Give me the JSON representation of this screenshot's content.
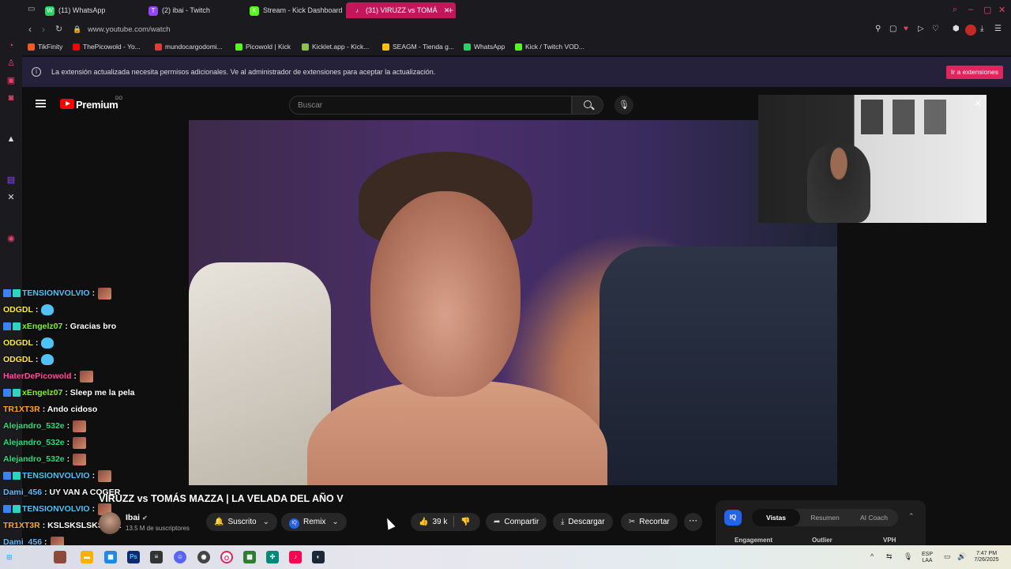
{
  "browser": {
    "tabs": [
      {
        "label": "(11) WhatsApp",
        "icon": "whatsapp-icon",
        "color": "#25d366",
        "glyph": "W"
      },
      {
        "label": "(2) ibai - Twitch",
        "icon": "twitch-icon",
        "color": "#9146ff",
        "glyph": "T"
      },
      {
        "label": "Stream - Kick Dashboard",
        "icon": "kick-icon",
        "color": "#53fc18",
        "glyph": "K"
      },
      {
        "label": "(31) VIRUZZ vs TOMÁ",
        "icon": "audio-icon",
        "color": "#c2185b",
        "glyph": "♪"
      }
    ],
    "new_tab": "+",
    "url": "www.youtube.com/watch",
    "bookmarks": [
      {
        "label": "TikFinity",
        "color": "#ff5722"
      },
      {
        "label": "ThePicowold - Yo...",
        "color": "#ff0000"
      },
      {
        "label": "mundocargodomi...",
        "color": "#e53935"
      },
      {
        "label": "Picowold | Kick",
        "color": "#53fc18"
      },
      {
        "label": "Kicklet.app - Kick...",
        "color": "#8bc34a"
      },
      {
        "label": "SEAGM - Tienda g...",
        "color": "#ffc107"
      },
      {
        "label": "WhatsApp",
        "color": "#25d366"
      },
      {
        "label": "Kick / Twitch VOD...",
        "color": "#53fc18"
      }
    ]
  },
  "notice": {
    "message": "La extensión actualizada necesita permisos adicionales. Ve al administrador de extensiones para aceptar la actualización.",
    "button": "Ir a extensiones"
  },
  "youtube": {
    "brand": "Premium",
    "brand_sup": "DO",
    "search_placeholder": "Buscar",
    "video_title": "VIRUZZ vs TOMÁS MAZZA | LA VELADA DEL AÑO V",
    "channel": {
      "name": "Ibai",
      "verified": "✔",
      "subscribers": "13.5 M de suscriptores"
    },
    "actions": {
      "subscribe": "Suscrito",
      "remix": "Remix",
      "likes": "39 k",
      "share": "Compartir",
      "download": "Descargar",
      "clip": "Recortar",
      "more": "⋯"
    }
  },
  "chat": [
    {
      "user": "TENSIONVOLVIO",
      "color": "#4fc3f7",
      "badges": true,
      "text": ":",
      "emote": "face"
    },
    {
      "user": "ODGDL",
      "color": "#ffeb3b",
      "badges": false,
      "text": ":",
      "emote": "cat"
    },
    {
      "user": "xEngelz07",
      "color": "#7cfc00",
      "badges": true,
      "text": ": Gracias bro",
      "emote": ""
    },
    {
      "user": "ODGDL",
      "color": "#ffeb3b",
      "badges": false,
      "text": ":",
      "emote": "cat"
    },
    {
      "user": "ODGDL",
      "color": "#ffeb3b",
      "badges": false,
      "text": ":",
      "emote": "cat"
    },
    {
      "user": "HaterDePicowold",
      "color": "#ff4fa3",
      "badges": false,
      "text": ":",
      "emote": "face"
    },
    {
      "user": "xEngelz07",
      "color": "#7cfc00",
      "badges": true,
      "text": ": Sleep me la pela",
      "emote": ""
    },
    {
      "user": "TR1XT3R",
      "color": "#ffa726",
      "badges": false,
      "text": ": Ando cidoso",
      "emote": ""
    },
    {
      "user": "Alejandro_532e",
      "color": "#26e07f",
      "badges": false,
      "text": ":",
      "emote": "face"
    },
    {
      "user": "Alejandro_532e",
      "color": "#26e07f",
      "badges": false,
      "text": ":",
      "emote": "face"
    },
    {
      "user": "Alejandro_532e",
      "color": "#26e07f",
      "badges": false,
      "text": ":",
      "emote": "face"
    },
    {
      "user": "TENSIONVOLVIO",
      "color": "#4fc3f7",
      "badges": true,
      "text": ":",
      "emote": "face"
    },
    {
      "user": "Dami_456",
      "color": "#64b5f6",
      "badges": false,
      "text": ": UY VAN A COGER",
      "emote": ""
    },
    {
      "user": "TENSIONVOLVIO",
      "color": "#4fc3f7",
      "badges": true,
      "text": ":",
      "emote": "face"
    },
    {
      "user": "TR1XT3R",
      "color": "#ffa726",
      "badges": false,
      "text": ": KSLSKSLSKSKAK",
      "emote": ""
    },
    {
      "user": "Dami_456",
      "color": "#64b5f6",
      "badges": false,
      "text": ":",
      "emote": "face"
    }
  ],
  "iq_panel": {
    "logo": "IQ",
    "tabs": [
      {
        "label": "Vistas",
        "active": true
      },
      {
        "label": "Resumen",
        "active": false
      },
      {
        "label": "AI Coach",
        "active": false
      }
    ],
    "columns": [
      "Engagement",
      "Outlier",
      "VPH"
    ]
  },
  "taskbar": {
    "lang": "ESP\nLAA",
    "time": "7:47 PM",
    "date": "7/26/2025"
  }
}
